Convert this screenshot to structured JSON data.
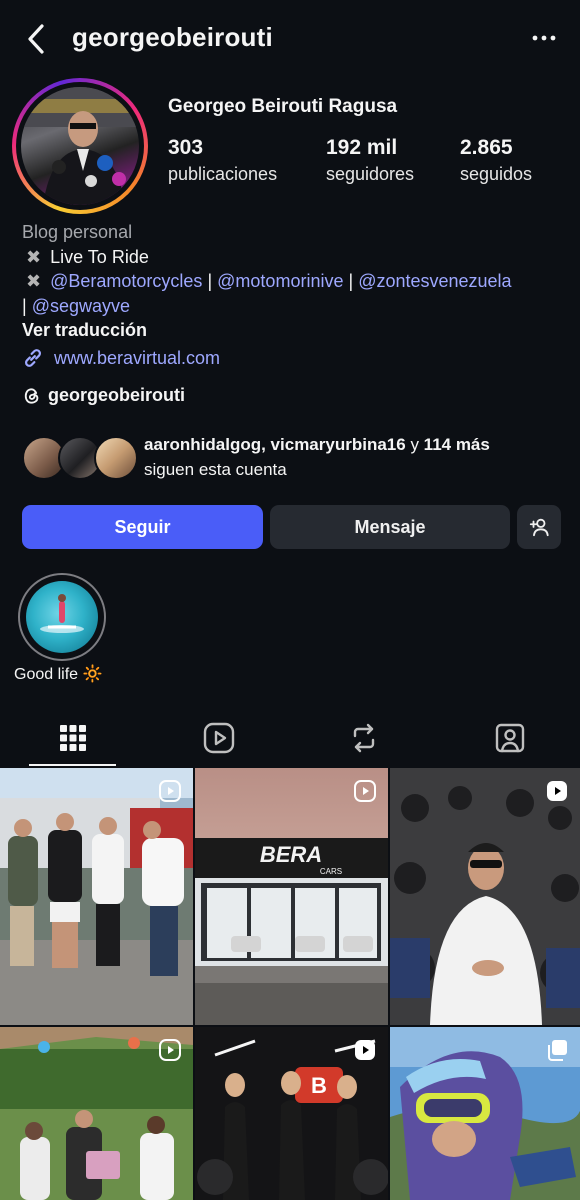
{
  "header": {
    "username": "georgeobeirouti",
    "back_icon": "chevron-left-icon",
    "more_icon": "more-horizontal-icon"
  },
  "profile": {
    "full_name": "Georgeo Beirouti Ragusa",
    "stats": [
      {
        "value": "303",
        "label": "publicaciones"
      },
      {
        "value": "192 mil",
        "label": "seguidores"
      },
      {
        "value": "2.865",
        "label": "seguidos"
      }
    ],
    "bio": {
      "category": "Blog personal",
      "line1": "Live To Ride",
      "mentions": [
        "@Beramotorcycles",
        "@motomorinive",
        "@zontesvenezuela",
        "@segwayve"
      ],
      "separator": "|",
      "translate": "Ver traducción",
      "website": "www.beravirtual.com"
    },
    "threads_handle": "georgeobeirouti"
  },
  "followed_by": {
    "names": "aaronhidalgog, vicmaryurbina16",
    "joiner": "y",
    "more": "114 más",
    "suffix": "siguen esta cuenta"
  },
  "actions": {
    "follow": "Seguir",
    "message": "Mensaje",
    "suggest_icon": "add-person-icon"
  },
  "highlights": [
    {
      "label": "Good life 🔆"
    }
  ],
  "tabs": [
    "grid-icon",
    "reels-icon",
    "reposts-icon",
    "tagged-icon"
  ],
  "colors": {
    "background": "#0c0f14",
    "follow_button": "#4a5df8",
    "secondary_button": "#262a31",
    "link": "#9ea8ff"
  },
  "posts": [
    {
      "type": "reel"
    },
    {
      "type": "reel",
      "sign_text": "BERA",
      "sign_sub": "CARS"
    },
    {
      "type": "reel"
    },
    {
      "type": "reel"
    },
    {
      "type": "reel"
    },
    {
      "type": "carousel"
    }
  ]
}
